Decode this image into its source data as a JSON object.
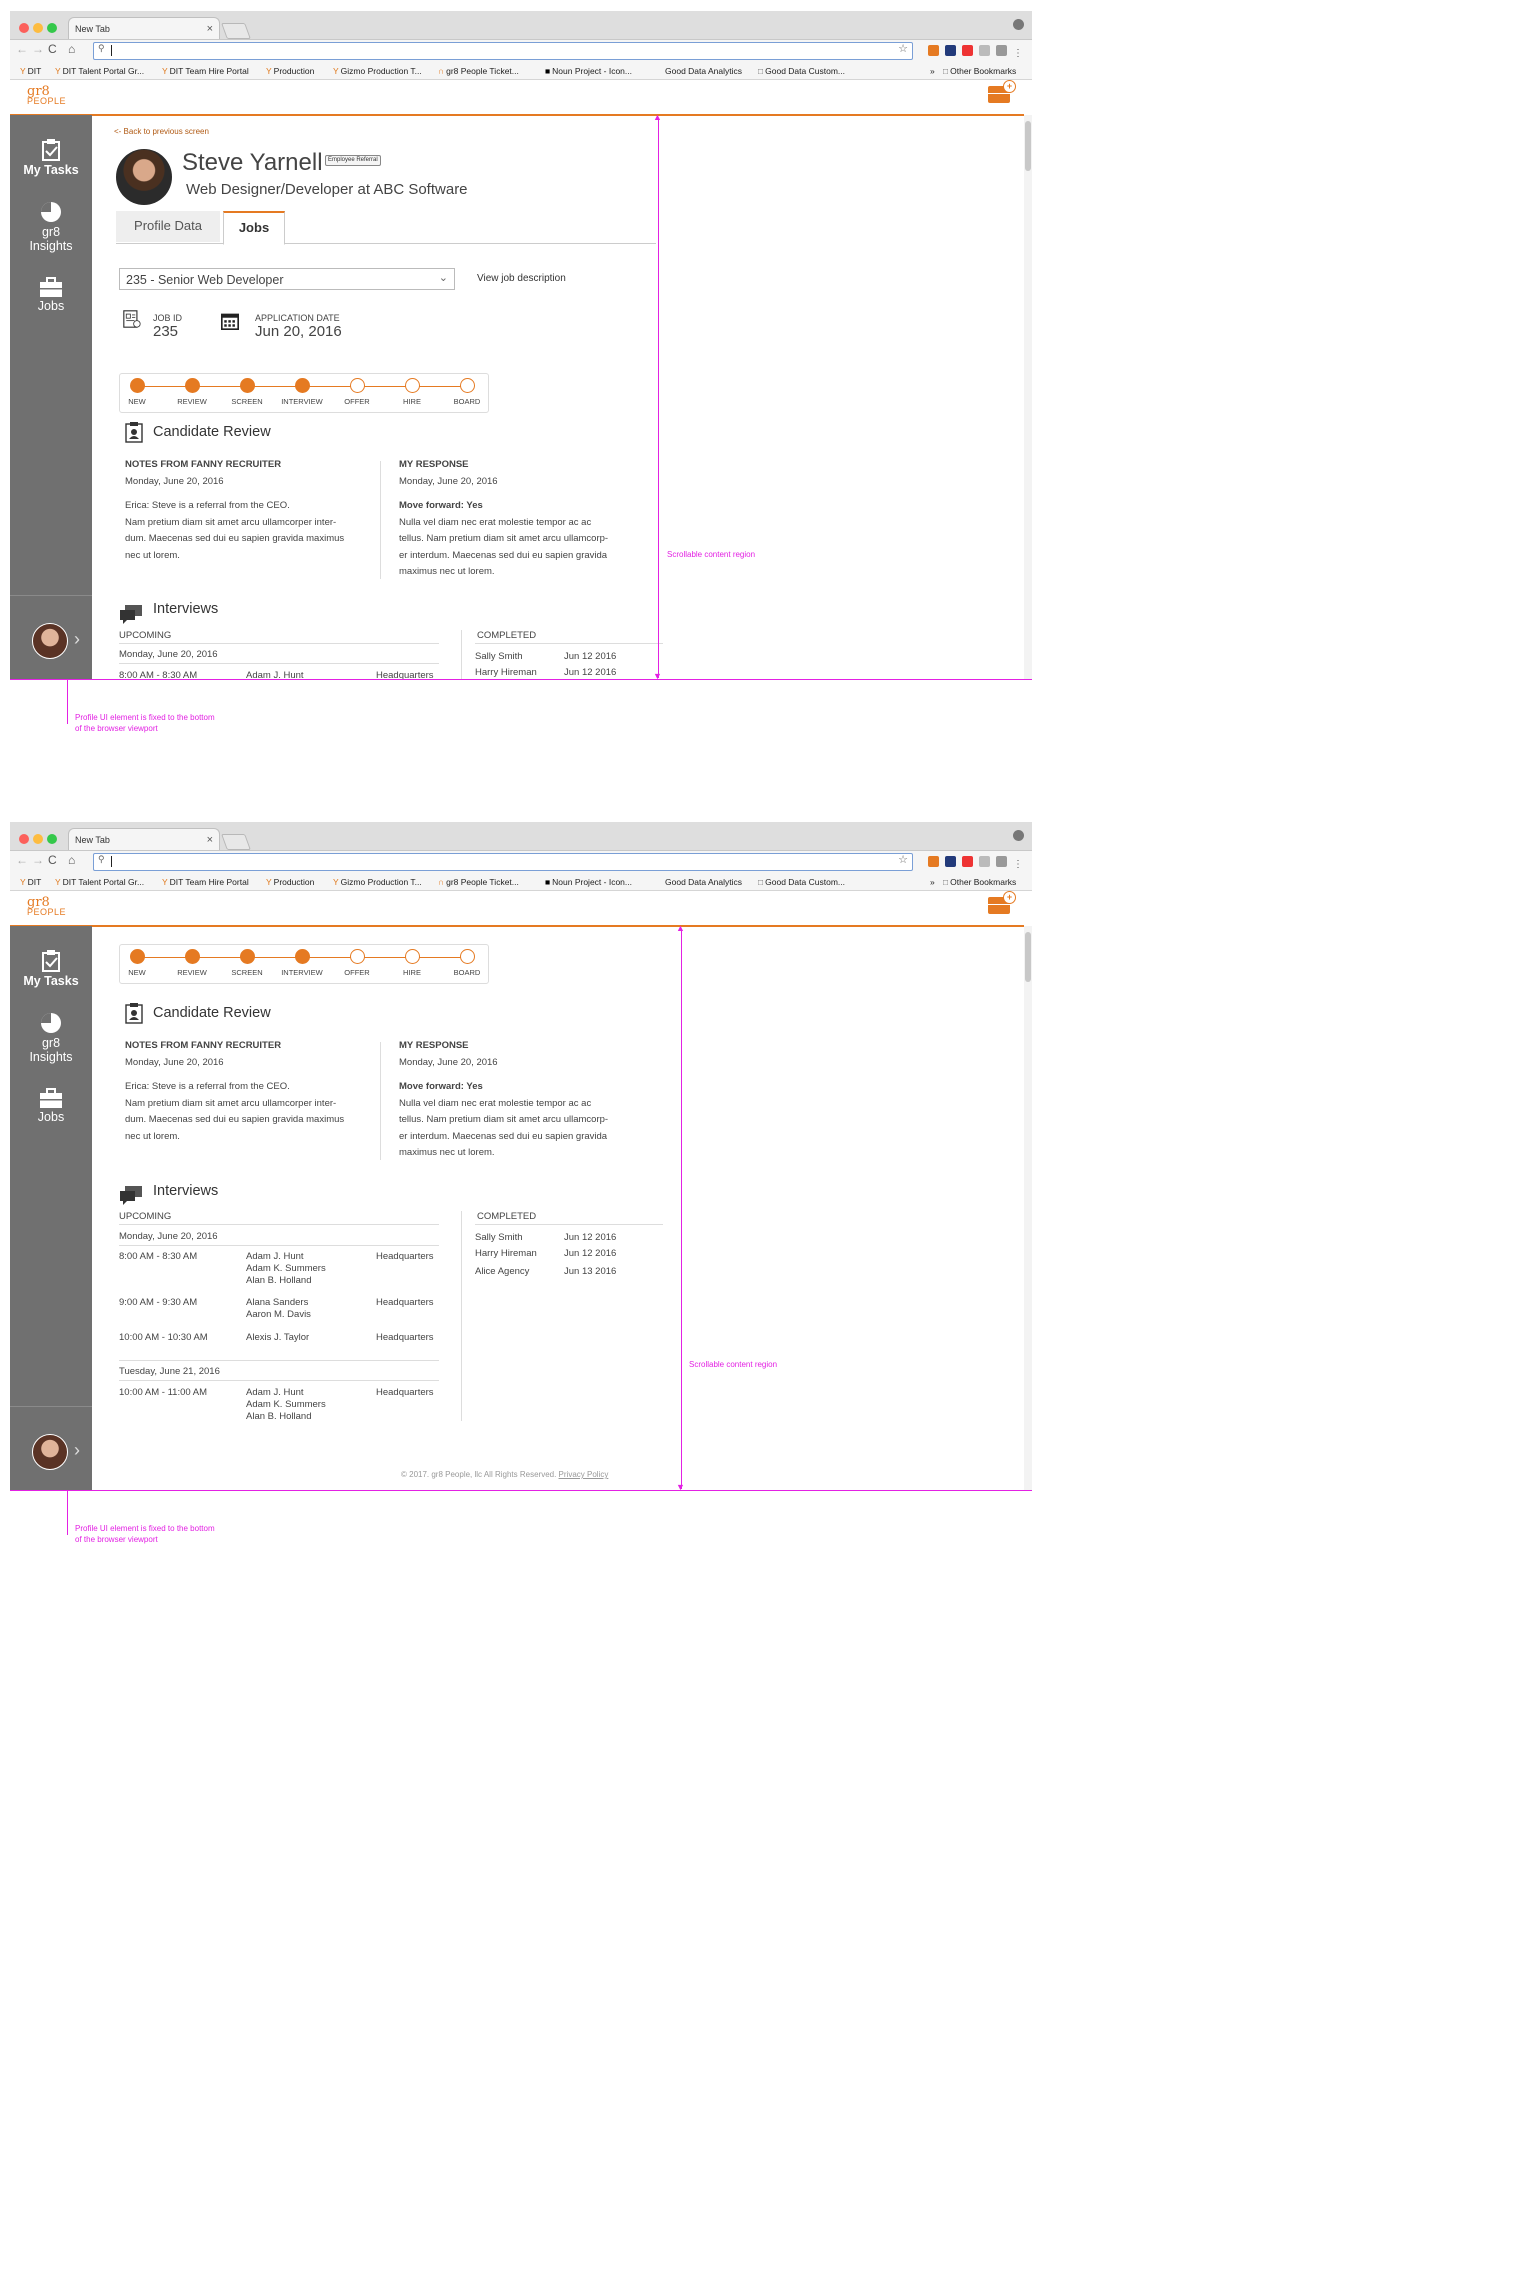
{
  "browser": {
    "tab_title": "New Tab",
    "tab_close": "×",
    "back": "←",
    "forward": "→",
    "reload": "C",
    "home": "⌂",
    "url": "",
    "bookmarks": [
      "DIT",
      "DIT Talent Portal Gr...",
      "DIT Team Hire Portal",
      "Production",
      "Gizmo Production T...",
      "gr8 People Ticket...",
      "Noun Project - Icon...",
      "Good Data Analytics",
      "Good Data Custom..."
    ],
    "overflow": "»",
    "other_bookmarks": "Other Bookmarks"
  },
  "app": {
    "logo_text": "gr8",
    "logo_sub": "PEOPLE",
    "accent": "#e57a22",
    "sidebar_bg": "#707070"
  },
  "sidebar": {
    "items": [
      {
        "label": "My Tasks",
        "icon": "clipboard-check-icon"
      },
      {
        "label": "gr8 Insights",
        "icon": "pie-chart-icon"
      },
      {
        "label": "Jobs",
        "icon": "briefcase-icon"
      }
    ],
    "chevron": "›"
  },
  "candidate": {
    "back_link": "<- Back to previous screen",
    "name": "Steve Yarnell",
    "badge": "Employee Referral",
    "title": "Web Designer/Developer at ABC Software",
    "tabs": [
      "Profile Data",
      "Jobs"
    ],
    "job_select": "235 - Senior Web Developer",
    "view_job": "View job description",
    "job_id_label": "JOB ID",
    "job_id": "235",
    "app_date_label": "APPLICATION DATE",
    "app_date": "Jun 20, 2016"
  },
  "pipeline": [
    {
      "label": "NEW",
      "done": true
    },
    {
      "label": "REVIEW",
      "done": true
    },
    {
      "label": "SCREEN",
      "done": true
    },
    {
      "label": "INTERVIEW",
      "done": true
    },
    {
      "label": "OFFER",
      "done": false
    },
    {
      "label": "HIRE",
      "done": false
    },
    {
      "label": "BOARD",
      "done": false
    }
  ],
  "review": {
    "title": "Candidate Review",
    "notes_heading": "NOTES FROM FANNY RECRUITER",
    "notes_date": "Monday, June 20, 2016",
    "notes_lines": [
      "Erica: Steve is a referral from the CEO.",
      "Nam pretium diam sit amet arcu ullamcorper inter-",
      "dum. Maecenas sed dui eu sapien gravida maximus",
      "nec ut lorem."
    ],
    "resp_heading": "MY RESPONSE",
    "resp_date": "Monday, June 20, 2016",
    "resp_decision": "Move forward: Yes",
    "resp_lines": [
      "Nulla vel diam nec erat molestie tempor ac ac",
      "tellus. Nam pretium diam sit amet arcu ullamcorp-",
      "er interdum. Maecenas sed dui eu sapien gravida",
      "maximus nec ut lorem."
    ]
  },
  "interviews": {
    "title": "Interviews",
    "upcoming_label": "UPCOMING",
    "completed_label": "COMPLETED",
    "day1": "Monday, June 20, 2016",
    "day2": "Tuesday, June 21, 2016",
    "upcoming": [
      {
        "time": "8:00 AM - 8:30 AM",
        "people": [
          "Adam J. Hunt",
          "Adam K. Summers",
          "Alan B. Holland"
        ],
        "place": "Headquarters"
      },
      {
        "time": "9:00 AM - 9:30 AM",
        "people": [
          "Alana Sanders",
          "Aaron M. Davis"
        ],
        "place": "Headquarters"
      },
      {
        "time": "10:00 AM - 10:30 AM",
        "people": [
          "Alexis J. Taylor"
        ],
        "place": "Headquarters"
      },
      {
        "time": "10:00 AM - 11:00 AM",
        "people": [
          "Adam J. Hunt",
          "Adam K. Summers",
          "Alan B. Holland"
        ],
        "place": "Headquarters"
      }
    ],
    "completed": [
      {
        "name": "Sally Smith",
        "date": "Jun 12 2016"
      },
      {
        "name": "Harry Hireman",
        "date": "Jun 12 2016"
      },
      {
        "name": "Alice Agency",
        "date": "Jun 13 2016"
      }
    ]
  },
  "footer": {
    "copyright": "© 2017. gr8 People, llc All Rights Reserved.",
    "privacy": "Privacy Policy"
  },
  "annotations": {
    "scroll_region": "Scrollable content region",
    "profile_fixed_1": "Profile UI element is fixed to the bottom",
    "profile_fixed_2": "of the browser viewport"
  }
}
